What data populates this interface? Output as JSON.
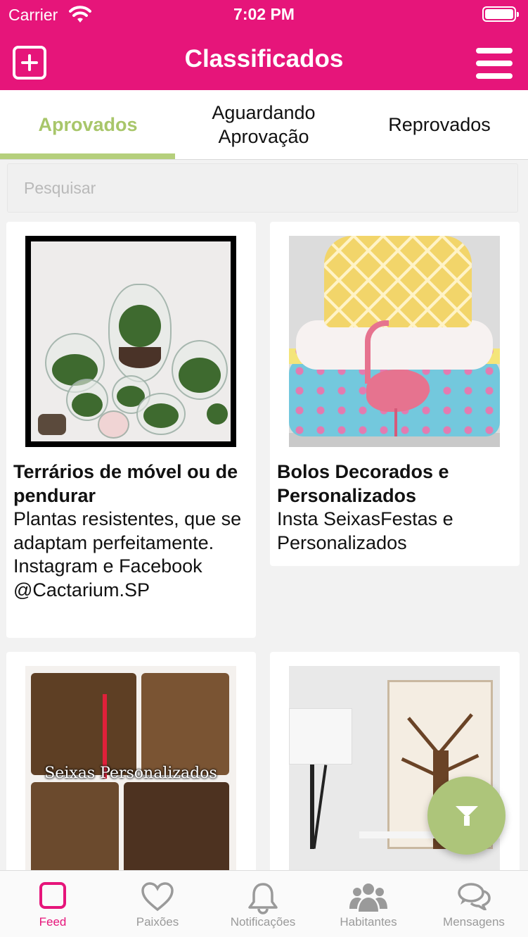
{
  "status_bar": {
    "carrier": "Carrier",
    "time": "7:02 PM"
  },
  "nav": {
    "title": "Classificados",
    "add_icon": "add-square-icon",
    "menu_icon": "hamburger-menu-icon"
  },
  "tabs": [
    {
      "label": "Aprovados",
      "active": true
    },
    {
      "label": "Aguardando\nAprovação",
      "active": false
    },
    {
      "label": "Reprovados",
      "active": false
    }
  ],
  "search": {
    "placeholder": "Pesquisar",
    "value": ""
  },
  "listings": [
    {
      "title": "Terrários de móvel ou de pendurar",
      "description": "Plantas resistentes, que se adaptam perfeitamente. Instagram e Facebook @Cactarium.SP"
    },
    {
      "title": "Bolos Decorados e Personalizados",
      "description": "Insta SeixasFestas e Personalizados"
    },
    {
      "title": "",
      "description": "",
      "image_caption": "Seixas Personalizados"
    },
    {
      "title": "",
      "description": ""
    }
  ],
  "fab": {
    "icon": "filter-icon"
  },
  "tab_bar": [
    {
      "label": "Feed",
      "icon": "feed-icon",
      "active": true
    },
    {
      "label": "Paixões",
      "icon": "heart-icon",
      "active": false
    },
    {
      "label": "Notificações",
      "icon": "bell-icon",
      "active": false
    },
    {
      "label": "Habitantes",
      "icon": "people-icon",
      "active": false
    },
    {
      "label": "Mensagens",
      "icon": "chat-icon",
      "active": false
    }
  ],
  "colors": {
    "brand": "#e6157a",
    "accent_green": "#a8c66a",
    "fab": "#adc57a"
  }
}
